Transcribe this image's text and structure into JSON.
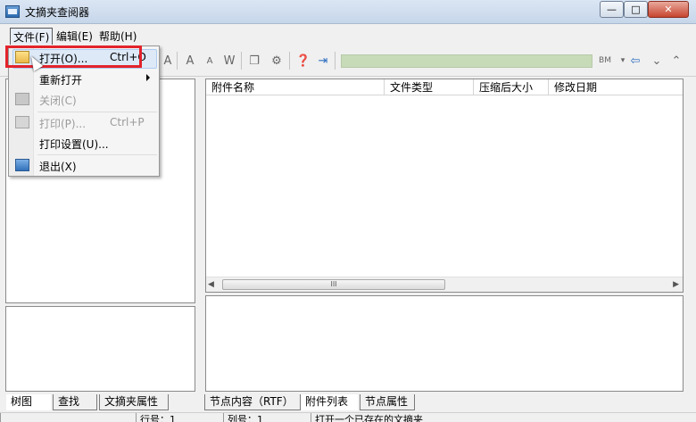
{
  "window": {
    "title": "文摘夹查阅器",
    "controls": {
      "minimize": "—",
      "maximize": "□",
      "close": "✕"
    }
  },
  "menubar": {
    "file": "文件(F)",
    "edit": "编辑(E)",
    "help": "帮助(H)"
  },
  "file_menu": {
    "items": [
      {
        "label": "打开(O)...",
        "accel": "Ctrl+O",
        "icon": "folder-open-icon",
        "enabled": true,
        "highlighted": true
      },
      {
        "label": "重新打开",
        "accel": "",
        "submenu": true,
        "enabled": true
      },
      {
        "label": "关闭(C)",
        "accel": "",
        "icon": "close-file-icon",
        "enabled": false
      },
      {
        "label": "打印(P)...",
        "accel": "Ctrl+P",
        "icon": "printer-icon",
        "enabled": false
      },
      {
        "label": "打印设置(U)...",
        "accel": "",
        "enabled": true
      },
      {
        "label": "退出(X)",
        "accel": "",
        "icon": "exit-icon",
        "enabled": true
      }
    ]
  },
  "toolbar": {
    "icons": [
      "font-size-increase-icon",
      "font-size-decrease-icon",
      "font-style-icon",
      "copy-icon",
      "settings-icon",
      "help-icon",
      "exit-icon",
      "bookmark-icon",
      "back-icon",
      "down-icon",
      "up-icon"
    ],
    "bm_label": "BM"
  },
  "attachment_list": {
    "columns": [
      "附件名称",
      "文件类型",
      "压缩后大小",
      "修改日期"
    ],
    "rows": [],
    "scroll_thumb": "III"
  },
  "left_tabs": [
    "树图",
    "查找",
    "文摘夹属性"
  ],
  "right_tabs": [
    "节点内容（RTF）",
    "附件列表",
    "节点属性"
  ],
  "statusbar": {
    "cells": [
      "",
      "行号：1",
      "列号：1",
      "打开一个已存在的文摘夹"
    ]
  },
  "colors": {
    "highlight_box": "#e3232b",
    "progress": "#c7dbb8",
    "menu_highlight": "#dde9f7"
  }
}
